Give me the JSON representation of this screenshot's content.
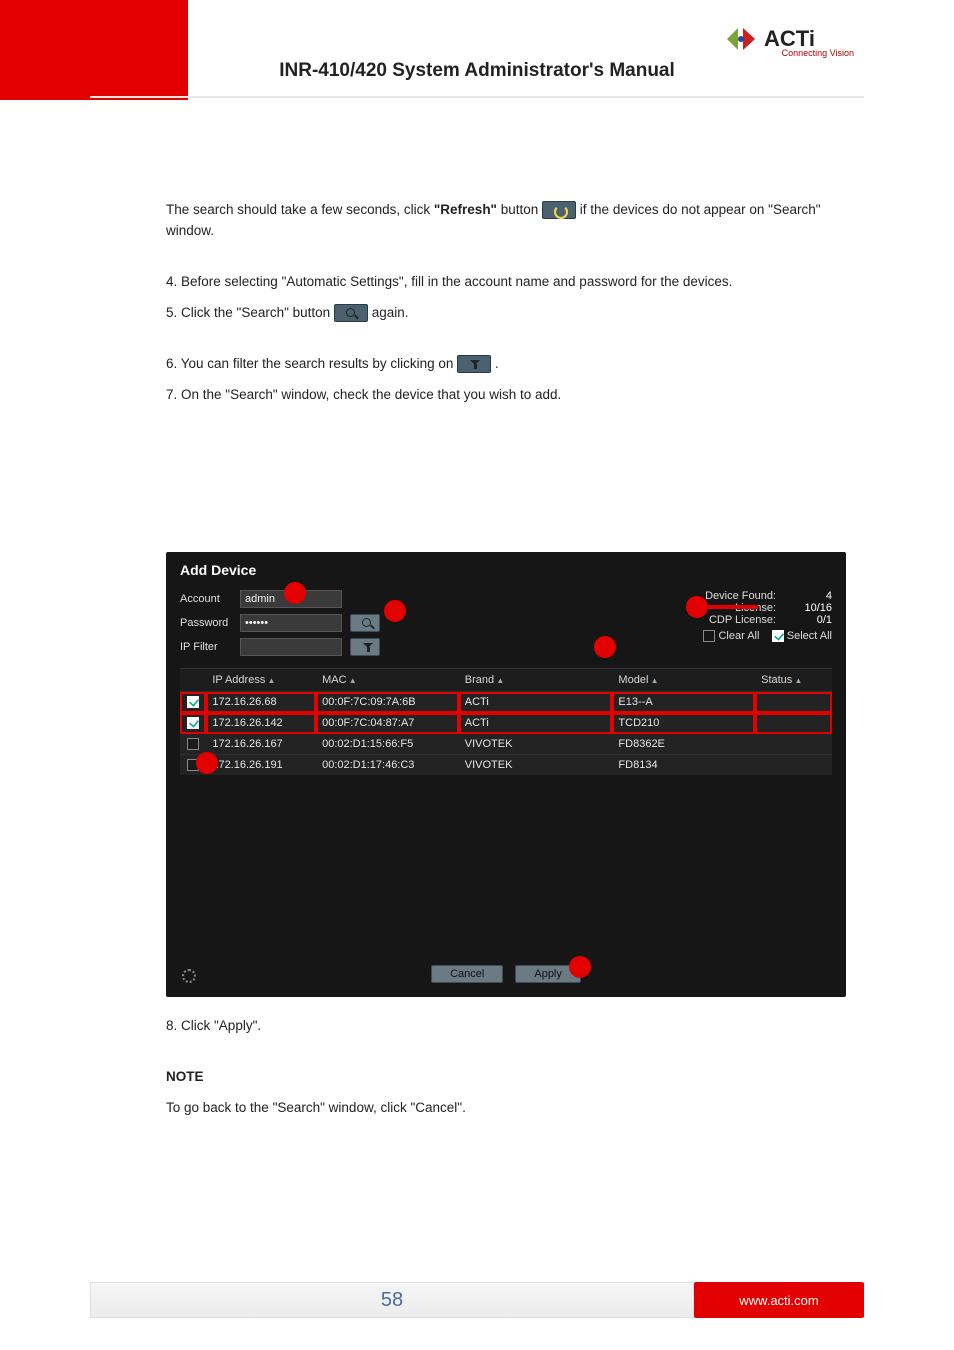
{
  "header": {
    "title": "INR-410/420 System Administrator's Manual",
    "brand": "ACTi",
    "brand_sub": "Connecting Vision"
  },
  "body": {
    "p1a": "The search should take a few seconds, click ",
    "p1bold": "\"Refresh\"",
    "p1b": " button ",
    "p1c": " if the devices do not appear on \"Search\" window.",
    "p2": "4. Before selecting \"Automatic Settings\", fill in the account name and password for the devices.",
    "p3a": "5. Click the \"Search\" button ",
    "p3b": " again.",
    "p4a": "6. You can filter the search results by clicking on ",
    "p4b": ".",
    "p5": "7. On the \"Search\" window, check the device that you wish to add.",
    "p6": "8. Click \"Apply\".",
    "p7": "NOTE",
    "p8": "To go back to the \"Search\" window, click \"Cancel\"."
  },
  "panel": {
    "title": "Add Device",
    "labels": {
      "account": "Account",
      "password": "Password",
      "ipfilter": "IP Filter"
    },
    "values": {
      "account": "admin",
      "password": "••••••",
      "ipfilter": ""
    },
    "stats": {
      "device_found_lbl": "Device Found:",
      "device_found_val": "4",
      "license_lbl": "License:",
      "license_val": "10/16",
      "cdp_lbl": "CDP License:",
      "cdp_val": "0/1",
      "clear_all": "Clear All",
      "select_all": "Select All"
    },
    "cols": {
      "ip": "IP Address",
      "mac": "MAC",
      "brand": "Brand",
      "model": "Model",
      "status": "Status"
    },
    "rows": [
      {
        "sel": true,
        "ip": "172.16.26.68",
        "mac": "00:0F:7C:09:7A:6B",
        "brand": "ACTi",
        "model": "E13--A",
        "status": ""
      },
      {
        "sel": true,
        "ip": "172.16.26.142",
        "mac": "00:0F:7C:04:87:A7",
        "brand": "ACTi",
        "model": "TCD210",
        "status": ""
      },
      {
        "sel": false,
        "ip": "172.16.26.167",
        "mac": "00:02:D1:15:66:F5",
        "brand": "VIVOTEK",
        "model": "FD8362E",
        "status": ""
      },
      {
        "sel": false,
        "ip": "172.16.26.191",
        "mac": "00:02:D1:17:46:C3",
        "brand": "VIVOTEK",
        "model": "FD8134",
        "status": ""
      }
    ],
    "buttons": {
      "cancel": "Cancel",
      "apply": "Apply"
    }
  },
  "footer": {
    "page": "58",
    "site": "www.acti.com"
  }
}
